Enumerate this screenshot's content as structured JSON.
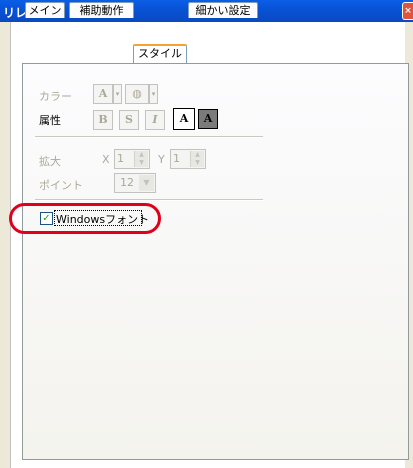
{
  "window": {
    "title": "リレー",
    "close_glyph": "×"
  },
  "tabs": [
    {
      "label": "メイン"
    },
    {
      "label": "補助動作"
    },
    {
      "label": "スタイル"
    },
    {
      "label": "細かい設定"
    }
  ],
  "style_panel": {
    "color_label": "カラー",
    "text_color_glyph": "A",
    "fill_color_glyph": "◍",
    "dropdown_glyph": "▾",
    "attribute_label": "属性",
    "attr_buttons": [
      "B",
      "S",
      "I",
      "A",
      "A"
    ],
    "scale_label": "拡大",
    "x_label": "X",
    "x_value": "1",
    "y_label": "Y",
    "y_value": "1",
    "point_label": "ポイント",
    "point_value": "12",
    "windows_font_label": "Windowsフォント",
    "windows_font_checked": true,
    "check_glyph": "✓"
  },
  "colors": {
    "accent_tab": "#f7a131",
    "highlight_oval": "#e1001a",
    "titlebar": "#0853d7"
  }
}
